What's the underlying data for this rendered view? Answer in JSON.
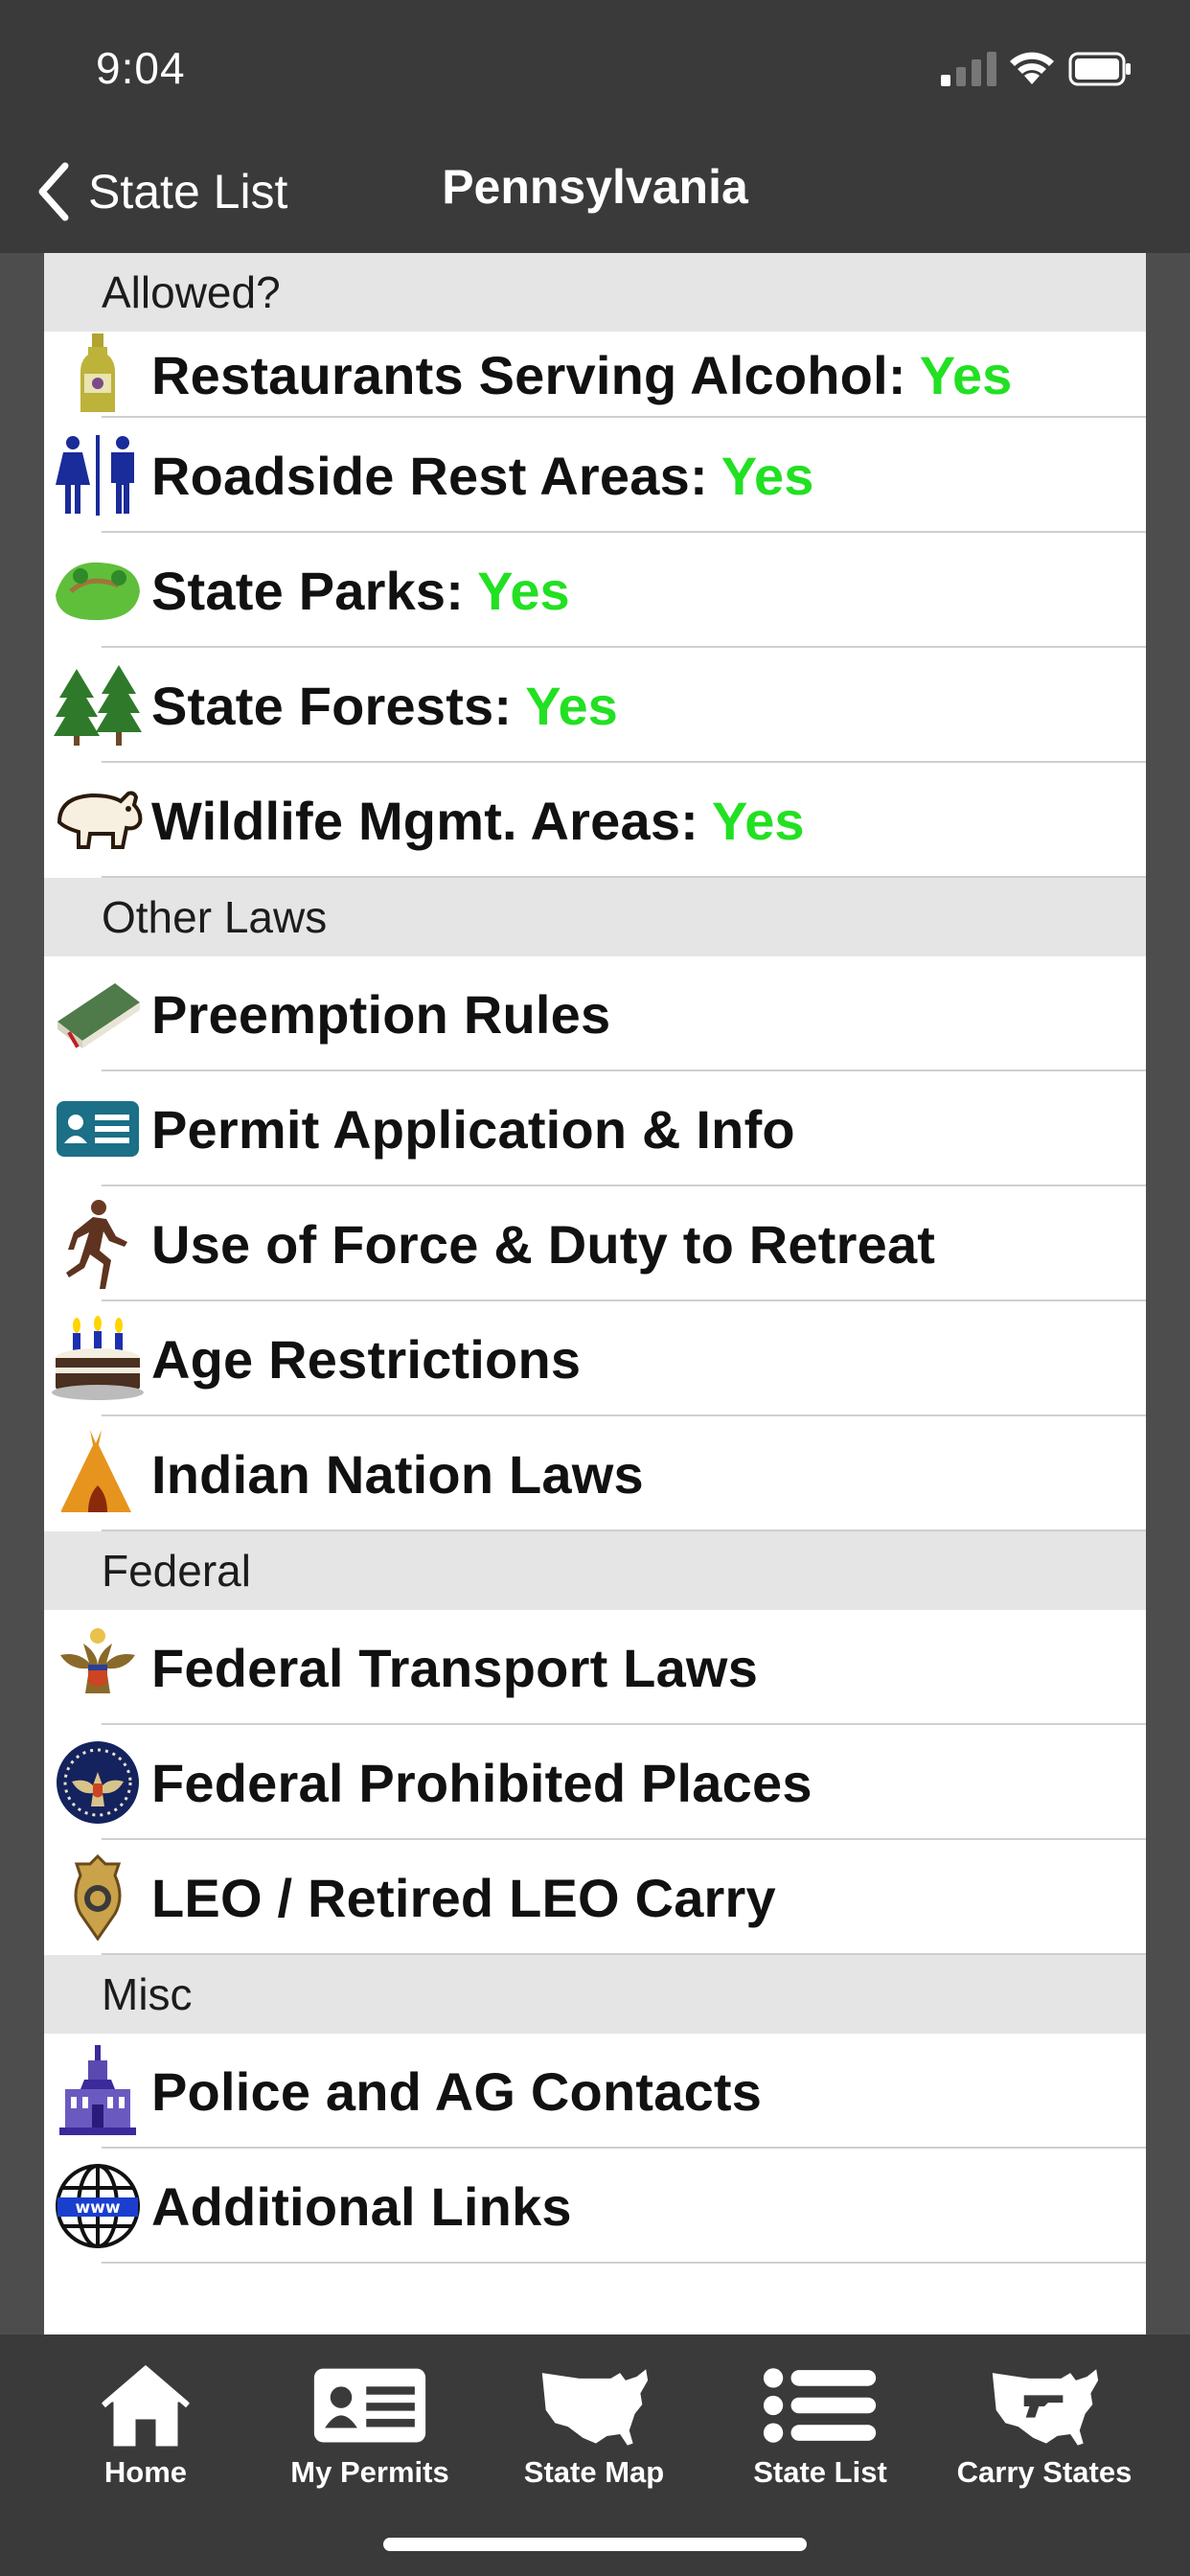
{
  "status_bar": {
    "time": "9:04"
  },
  "nav": {
    "back_label": "State List",
    "title": "Pennsylvania"
  },
  "sections": {
    "allowed": "Allowed?",
    "other_laws": "Other Laws",
    "federal": "Federal",
    "misc": "Misc"
  },
  "allowed_items": [
    {
      "label": "Restaurants Serving Alcohol:",
      "value": "Yes",
      "icon": "wine-bottle-icon"
    },
    {
      "label": "Roadside Rest Areas:",
      "value": "Yes",
      "icon": "restroom-icon"
    },
    {
      "label": "State Parks:",
      "value": "Yes",
      "icon": "park-icon"
    },
    {
      "label": "State Forests:",
      "value": "Yes",
      "icon": "pine-trees-icon"
    },
    {
      "label": "Wildlife Mgmt. Areas:",
      "value": "Yes",
      "icon": "bear-icon"
    }
  ],
  "other_laws_items": [
    {
      "label": "Preemption Rules",
      "icon": "law-book-icon"
    },
    {
      "label": "Permit Application & Info",
      "icon": "id-card-icon"
    },
    {
      "label": "Use of Force & Duty to Retreat",
      "icon": "running-man-icon"
    },
    {
      "label": "Age Restrictions",
      "icon": "birthday-cake-icon"
    },
    {
      "label": "Indian Nation Laws",
      "icon": "teepee-icon"
    }
  ],
  "federal_items": [
    {
      "label": "Federal Transport Laws",
      "icon": "eagle-seal-icon"
    },
    {
      "label": "Federal Prohibited Places",
      "icon": "presidential-seal-icon"
    },
    {
      "label": "LEO / Retired LEO Carry",
      "icon": "police-badge-icon"
    }
  ],
  "misc_items": [
    {
      "label": "Police and AG Contacts",
      "icon": "capitol-building-icon"
    },
    {
      "label": "Additional Links",
      "icon": "globe-www-icon"
    }
  ],
  "tabs": [
    {
      "label": "Home",
      "icon": "home-icon"
    },
    {
      "label": "My Permits",
      "icon": "permit-card-icon"
    },
    {
      "label": "State Map",
      "icon": "usa-map-icon"
    },
    {
      "label": "State List",
      "icon": "list-icon"
    },
    {
      "label": "Carry States",
      "icon": "usa-gun-map-icon"
    }
  ],
  "colors": {
    "yes": "#22e022",
    "bar": "#3a3a3a",
    "section": "#e5e5e5"
  }
}
